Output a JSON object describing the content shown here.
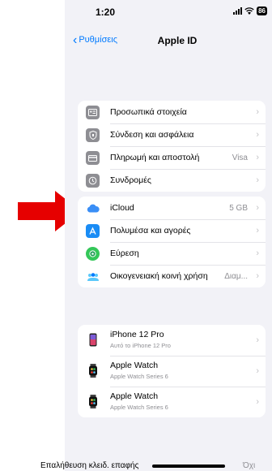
{
  "status": {
    "time": "1:20",
    "battery": "86"
  },
  "nav": {
    "back_label": "Ρυθμίσεις",
    "title": "Apple ID"
  },
  "account_rows": [
    {
      "label": "Προσωπικά στοιχεία",
      "value": "",
      "icon": "id-card-icon"
    },
    {
      "label": "Σύνδεση και ασφάλεια",
      "value": "",
      "icon": "shield-icon"
    },
    {
      "label": "Πληρωμή και αποστολή",
      "value": "Visa",
      "icon": "credit-card-icon"
    },
    {
      "label": "Συνδρομές",
      "value": "",
      "icon": "subscriptions-icon"
    }
  ],
  "service_rows": [
    {
      "label": "iCloud",
      "value": "5 GB",
      "icon": "icloud-icon"
    },
    {
      "label": "Πολυμέσα και αγορές",
      "value": "",
      "icon": "app-store-icon"
    },
    {
      "label": "Εύρεση",
      "value": "",
      "icon": "find-my-icon"
    },
    {
      "label": "Οικογενειακή κοινή χρήση",
      "value": "Διαμ...",
      "icon": "family-sharing-icon"
    }
  ],
  "devices": [
    {
      "name": "iPhone 12 Pro",
      "subtitle": "Αυτό το iPhone 12 Pro",
      "icon": "iphone-icon"
    },
    {
      "name": "Apple Watch",
      "subtitle": "Apple Watch Series 6",
      "icon": "apple-watch-icon"
    },
    {
      "name": "Apple Watch",
      "subtitle": "Apple Watch Series 6",
      "icon": "apple-watch-icon"
    }
  ],
  "footer": {
    "text": "Επαλήθευση κλειδ. επαφής",
    "value": "Όχι"
  },
  "colors": {
    "accent": "#007aff",
    "arrow": "#e60000",
    "background": "#f2f2f7"
  }
}
